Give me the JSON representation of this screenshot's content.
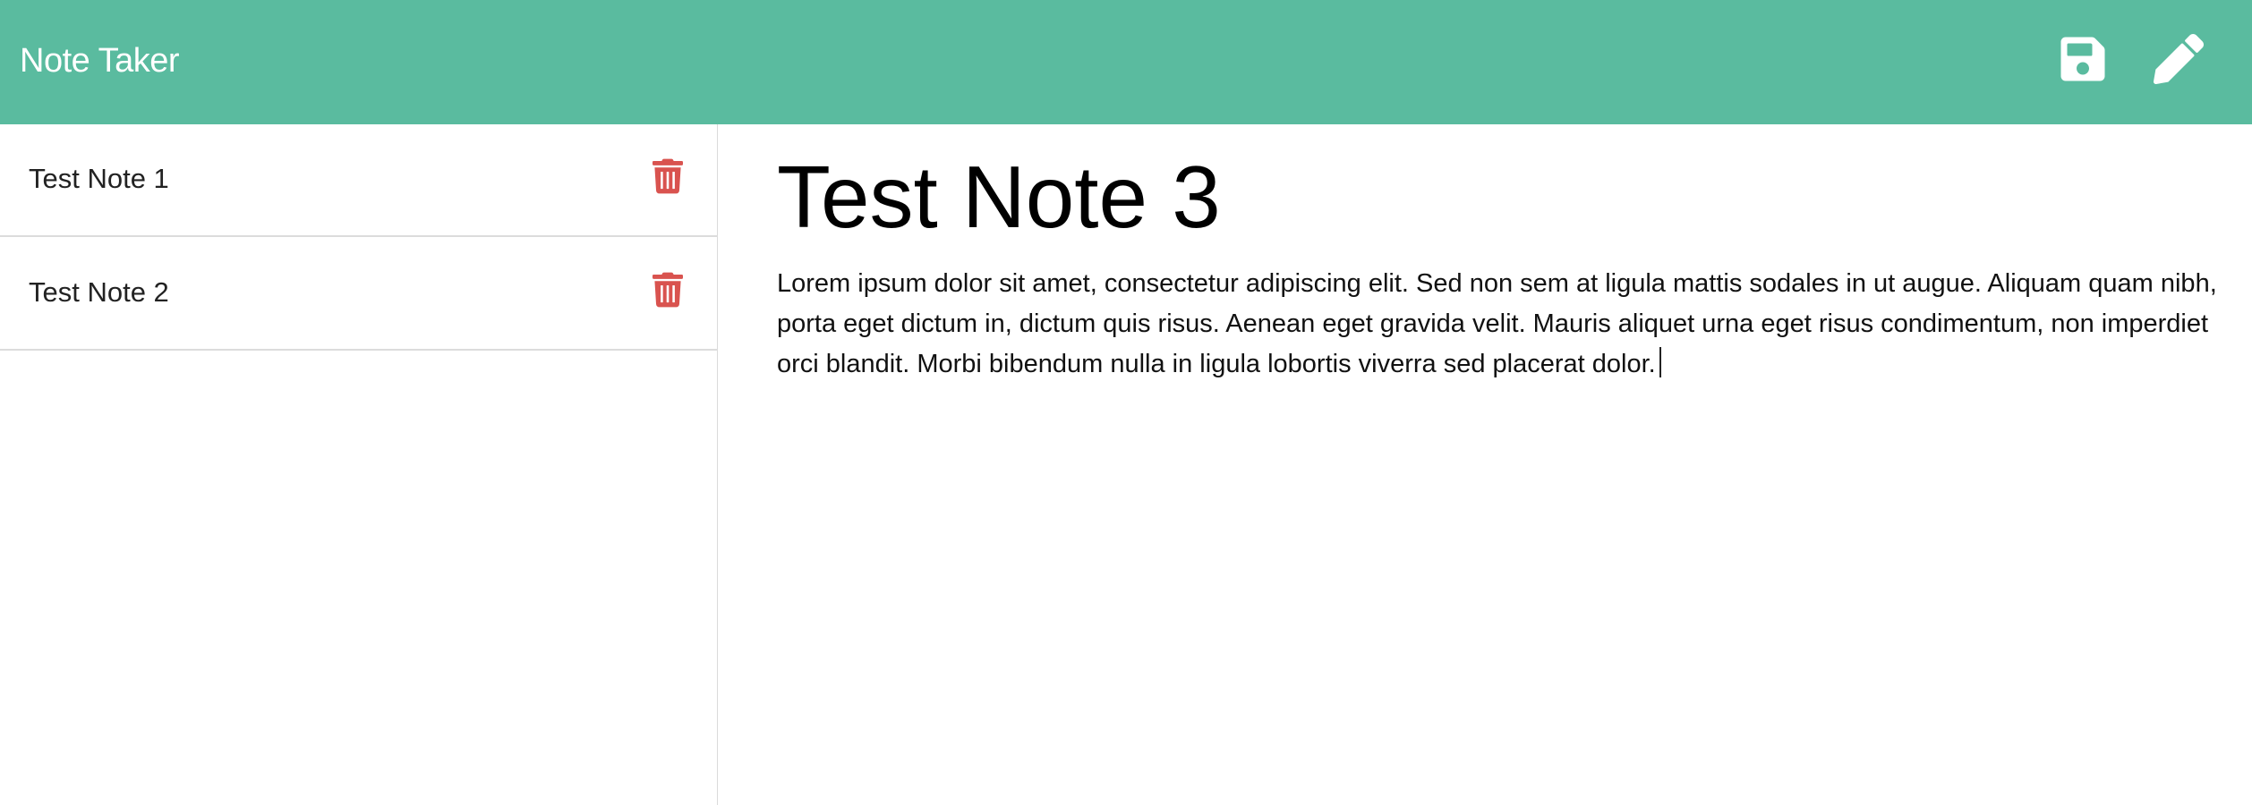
{
  "app": {
    "title": "Note Taker",
    "accent_color": "#5abb9f",
    "delete_color": "#d9534f"
  },
  "toolbar": {
    "save_icon": "save-icon",
    "write_icon": "pencil-icon"
  },
  "notes": [
    {
      "title": "Test Note 1",
      "delete_icon": "trash-icon"
    },
    {
      "title": "Test Note 2",
      "delete_icon": "trash-icon"
    }
  ],
  "editor": {
    "title": "Test Note 3",
    "text": "Lorem ipsum dolor sit amet, consectetur adipiscing elit. Sed non sem at ligula mattis sodales in ut augue. Aliquam quam nibh, porta eget dictum in, dictum quis risus. Aenean eget gravida velit. Mauris aliquet urna eget risus condimentum, non imperdiet orci blandit. Morbi bibendum nulla in ligula lobortis viverra sed placerat dolor."
  }
}
